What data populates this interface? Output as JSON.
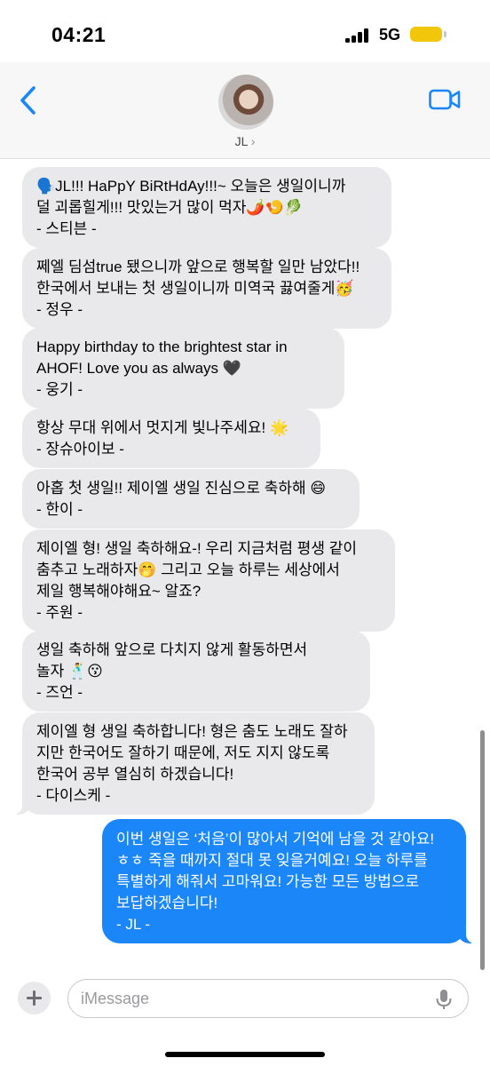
{
  "status_bar": {
    "time": "04:21",
    "network": "5G",
    "battery_color": "#f2c70b"
  },
  "header": {
    "contact_name": "JL",
    "back_icon": "chevron-left-icon",
    "video_icon": "video-camera-icon",
    "accent_color": "#1a86f8"
  },
  "messages": [
    {
      "from": "other",
      "text": "🗣️JL!!! HaPpY BiRtHdAy!!!~ 오늘은 생일이니까\n덜 괴롭힐게!!! 맛있는거 많이 먹자🌶️🍤🥬\n- 스티븐 -"
    },
    {
      "from": "other",
      "text": "쩨엘 딤섬true 됐으니까 앞으로 행복할 일만 남았다!!\n한국에서 보내는 첫 생일이니까 미역국 끓여줄게🥳\n- 정우 -"
    },
    {
      "from": "other",
      "text": "Happy birthday to the brightest star in\nAHOF! Love you as always 🖤\n- 웅기 -"
    },
    {
      "from": "other",
      "text": "항상 무대 위에서 멋지게 빛나주세요! 🌟\n- 장슈아이보 -"
    },
    {
      "from": "other",
      "text": "아홉 첫 생일!! 제이엘 생일 진심으로 축하해 😄\n- 한이 -"
    },
    {
      "from": "other",
      "text": "제이엘 형! 생일 축하해요-! 우리 지금처럼 평생 같이\n춤추고 노래하자🤭 그리고 오늘 하루는 세상에서\n제일 행복해야해요~ 알죠?\n- 주원 -"
    },
    {
      "from": "other",
      "text": "생일 축하해 앞으로 다치지 않게 활동하면서\n놀자 🕺😗\n- 즈언 -"
    },
    {
      "from": "other",
      "text": "제이엘 형 생일 축하합니다! 형은 춤도 노래도 잘하\n지만 한국어도 잘하기 때문에, 저도 지지 않도록\n한국어 공부 열심히 하겠습니다!\n- 다이스케 -"
    },
    {
      "from": "me",
      "text": "이번 생일은 ‘처음’이 많아서 기억에 남을 것 같아요!\nㅎㅎ 죽을 때까지 절대 못 잊을거예요! 오늘 하루를\n특별하게 해줘서 고마워요! 가능한 모든 방법으로\n보답하겠습니다!\n- JL -"
    }
  ],
  "composer": {
    "placeholder": "iMessage",
    "plus_icon": "plus-icon",
    "mic_icon": "microphone-icon"
  }
}
